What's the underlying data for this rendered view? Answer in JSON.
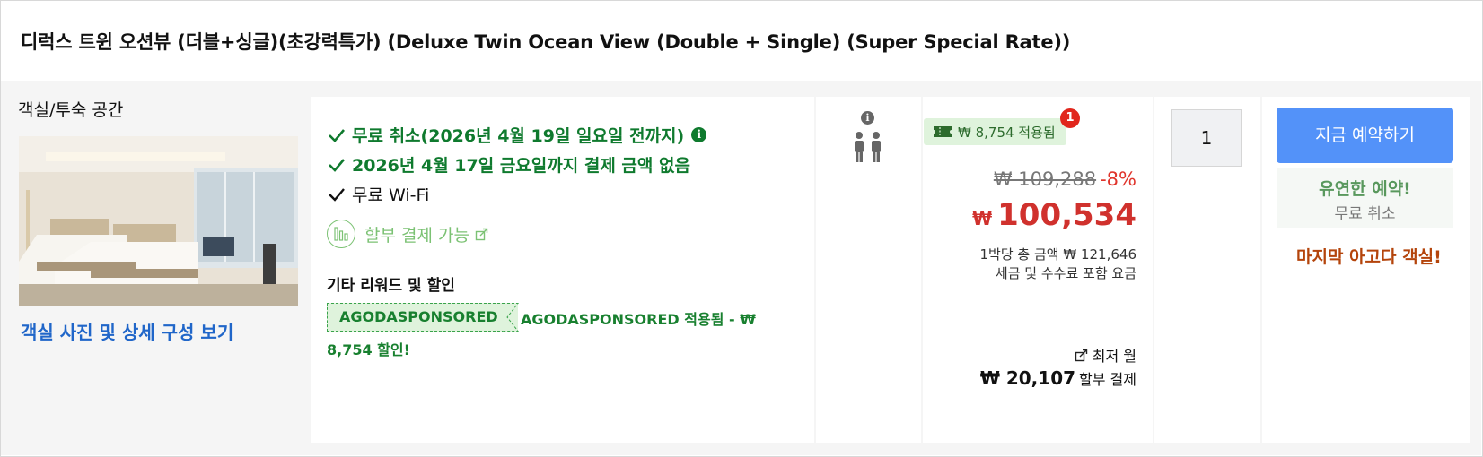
{
  "room": {
    "title": "디럭스 트윈 오션뷰 (더블+싱글)(초강력특가) (Deluxe Twin Ocean View (Double + Single) (Super Special Rate))",
    "space_label": "객실/투숙 공간",
    "photos_link": "객실 사진 및 상세 구성 보기"
  },
  "benefits": {
    "free_cancel": "무료 취소(2026년 4월 19일 일요일 전까지)",
    "pay_later": "2026년 4월 17일 금요일까지 결제 금액 없음",
    "wifi": "무료 Wi-Fi",
    "installment": "할부 결제 가능"
  },
  "rewards": {
    "title": "기타 리워드 및 할인",
    "promo_code": "AGODASPONSORED",
    "promo_text": "AGODASPONSORED 적용됨 - ₩ 8,754 할인!"
  },
  "occupancy": {
    "guests": 2
  },
  "price": {
    "coupon_text": "₩ 8,754 적용됨",
    "coupon_badge": "1",
    "original": "₩ 109,288",
    "discount": "-8%",
    "currency": "₩",
    "final": "100,534",
    "total_note": "1박당 총 금액 ₩ 121,646",
    "tax_note": "세금 및 수수료 포함 요금",
    "monthly_label": "최저 월",
    "monthly_amount": "₩ 20,107",
    "monthly_suffix": "할부 결제"
  },
  "quantity": {
    "value": "1"
  },
  "booking": {
    "button": "지금 예약하기",
    "flex_title": "유연한 예약!",
    "flex_sub": "무료 취소",
    "urgency": "마지막 아고다 객실!"
  },
  "colors": {
    "accent_blue": "#5392f9",
    "benefit_green": "#0f7a2e",
    "price_red": "#d0312d",
    "urgency_orange": "#b4440b"
  }
}
